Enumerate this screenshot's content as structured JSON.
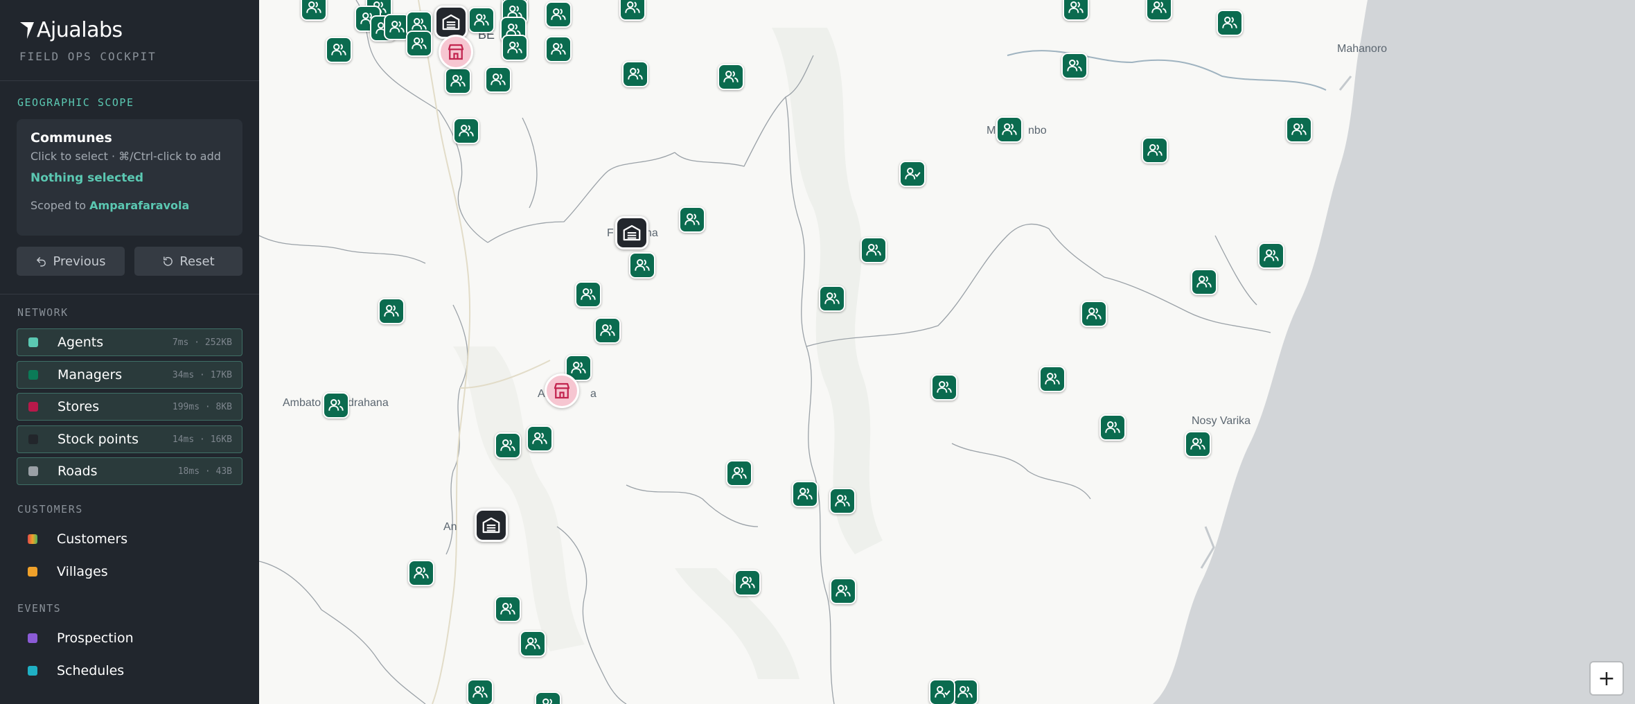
{
  "brand": {
    "name": "Ajualabs",
    "subtitle": "FIELD OPS COCKPIT"
  },
  "scope": {
    "section_title": "GEOGRAPHIC SCOPE",
    "card_title": "Communes",
    "hint": "Click to select · ⌘/Ctrl-click to add",
    "selection": "Nothing selected",
    "scoped_prefix": "Scoped to",
    "scoped_value": "Amparafaravola",
    "previous_label": "Previous",
    "reset_label": "Reset"
  },
  "network": {
    "title": "NETWORK",
    "layers": [
      {
        "label": "Agents",
        "meta": "7ms · 252KB",
        "color": "#5bc8b2"
      },
      {
        "label": "Managers",
        "meta": "34ms · 17KB",
        "color": "#0b7a57"
      },
      {
        "label": "Stores",
        "meta": "199ms · 8KB",
        "color": "#b8194a"
      },
      {
        "label": "Stock points",
        "meta": "14ms · 16KB",
        "color": "#22262b"
      },
      {
        "label": "Roads",
        "meta": "18ms · 43B",
        "color": "#9aa0a6"
      }
    ]
  },
  "customers": {
    "title": "CUSTOMERS",
    "items": [
      {
        "label": "Customers",
        "color": "gradient"
      },
      {
        "label": "Villages",
        "color": "#f0a12a"
      }
    ]
  },
  "events": {
    "title": "EVENTS",
    "items": [
      {
        "label": "Prospection",
        "color": "#8b5bd6"
      },
      {
        "label": "Schedules",
        "color": "#1fb0c4"
      }
    ]
  },
  "map": {
    "labels": [
      "Mahanoro",
      "Ma",
      "nbo",
      "Ambato",
      "drahana",
      "Nosy Varika",
      "An",
      "be",
      "BE",
      "a",
      "A",
      "na",
      "F"
    ],
    "zoom_in_label": "+",
    "marker_icons": {
      "agent": "users-icon",
      "manager": "user-check-icon",
      "stock": "warehouse-icon",
      "store": "store-icon"
    }
  }
}
